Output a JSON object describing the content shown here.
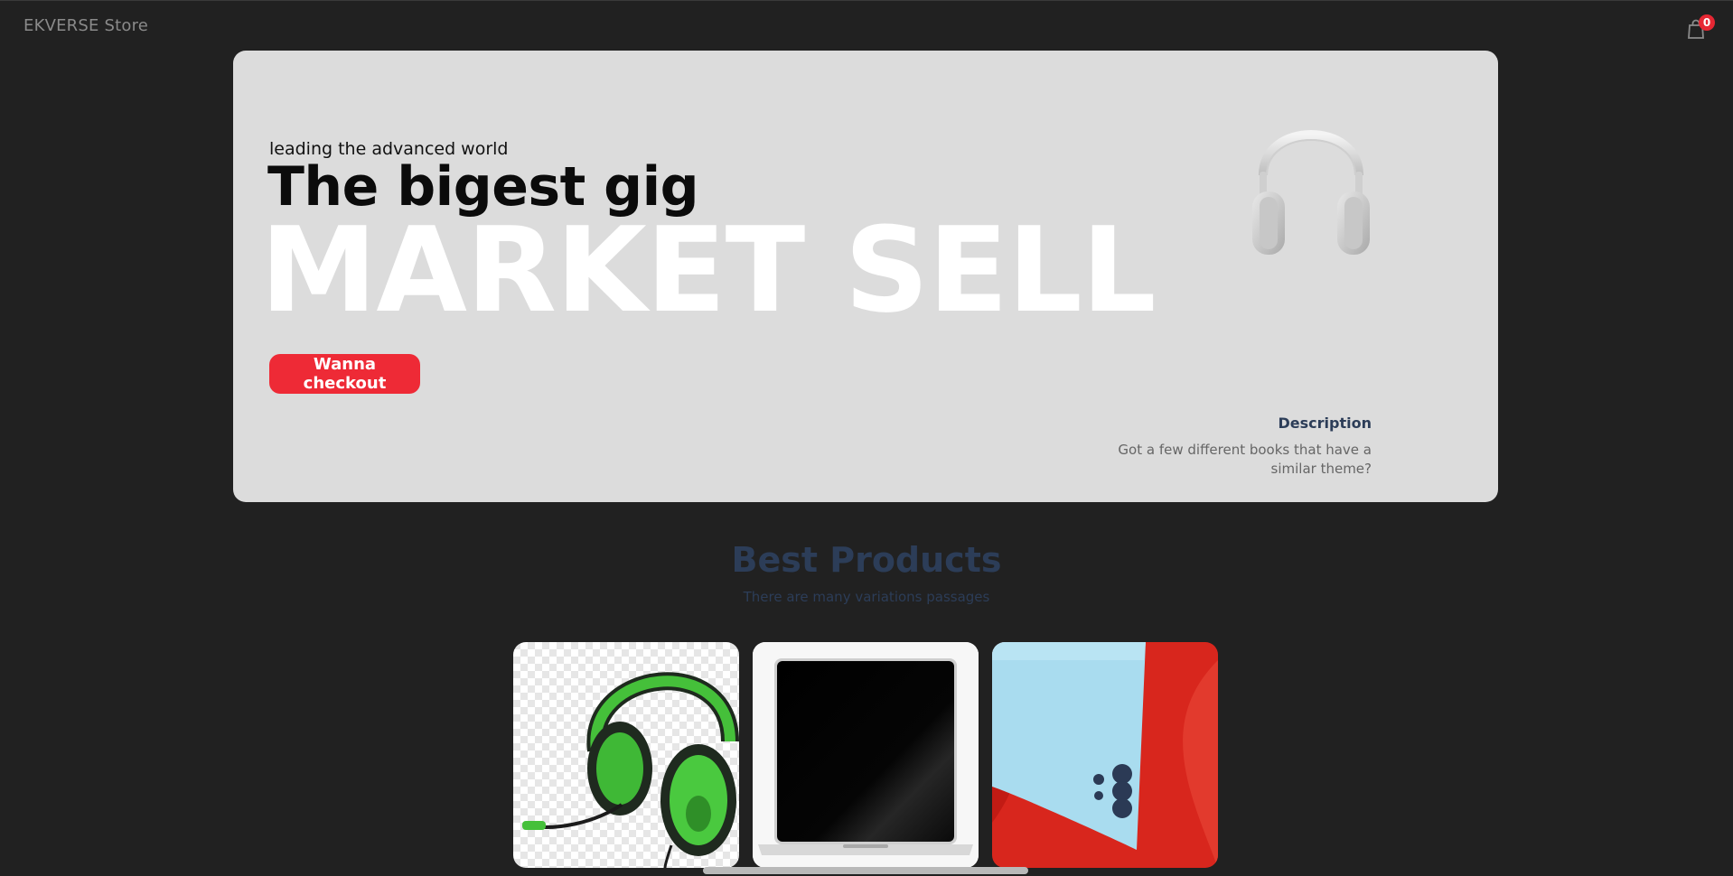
{
  "navbar": {
    "brand": "EKVERSE Store",
    "cart_icon": "shopping-bag-icon",
    "cart_count": "0"
  },
  "hero": {
    "kicker": "leading the advanced world",
    "title": "The bigest gig",
    "big_text": "MARKET SELL",
    "button_label": "Wanna checkout",
    "image": "white-headphones",
    "description_heading": "Description",
    "description_text": "Got a few different books that have a similar theme?"
  },
  "products": {
    "title": "Best Products",
    "subtitle": "There are many variations passages",
    "items": [
      {
        "image": "green-gaming-headset"
      },
      {
        "image": "laptop"
      },
      {
        "image": "blue-smartphone"
      }
    ]
  },
  "colors": {
    "background": "#212121",
    "hero_bg": "#dcdcdc",
    "accent_red": "#ee2a36",
    "heading_blue": "#2c3d58"
  }
}
